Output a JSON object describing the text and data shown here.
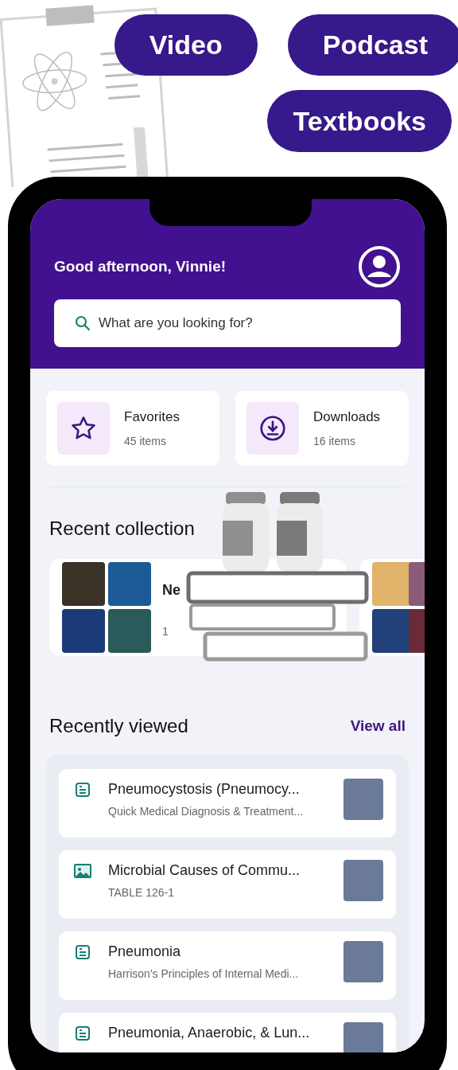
{
  "pills": [
    {
      "label": "Video"
    },
    {
      "label": "Podcast"
    },
    {
      "label": "Textbooks"
    }
  ],
  "header": {
    "greeting": "Good afternoon, Vinnie!"
  },
  "search": {
    "placeholder": "What are you looking for?"
  },
  "shortcuts": [
    {
      "kind": "star",
      "title": "Favorites",
      "count": "45 items"
    },
    {
      "kind": "download",
      "title": "Downloads",
      "count": "16 items"
    }
  ],
  "recent_collections": {
    "title": "Recent collection",
    "cards": [
      {
        "title": "Ne",
        "subtitle": "1"
      }
    ]
  },
  "recently_viewed": {
    "title": "Recently viewed",
    "action": "View all",
    "items": [
      {
        "kind": "article",
        "title": "Pneumocystosis (Pneumocy...",
        "subtitle": "Quick Medical Diagnosis & Treatment..."
      },
      {
        "kind": "image",
        "title": "Microbial Causes of Commu...",
        "subtitle": "TABLE 126-1"
      },
      {
        "kind": "article",
        "title": "Pneumonia",
        "subtitle": "Harrison's Principles of Internal Medi..."
      },
      {
        "kind": "article",
        "title": "Pneumonia, Anaerobic, & Lun..."
      }
    ]
  }
}
